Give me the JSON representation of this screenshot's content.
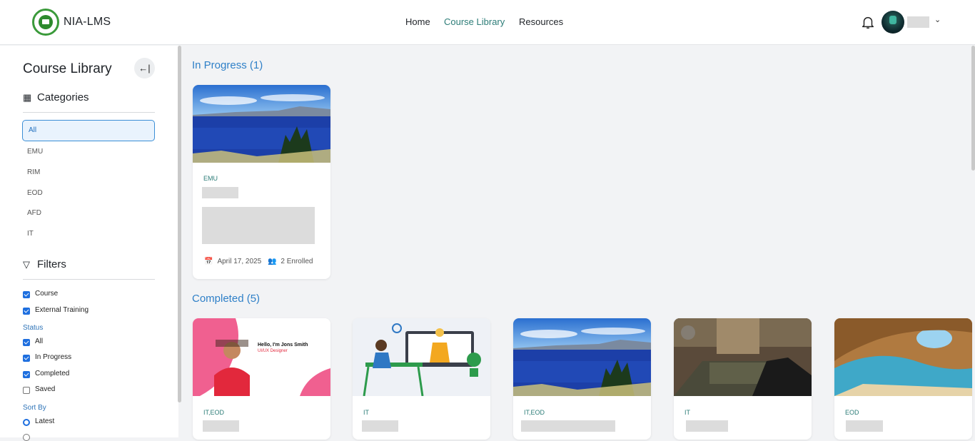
{
  "header": {
    "brand": "NIA-LMS",
    "nav": [
      {
        "label": "Home",
        "active": false
      },
      {
        "label": "Course Library",
        "active": true
      },
      {
        "label": "Resources",
        "active": false
      }
    ],
    "icons": [
      "bell-icon",
      "avatar",
      "chevron-down-icon"
    ]
  },
  "sidebar": {
    "title": "Course Library",
    "collapse_icon": "←|",
    "categories_label": "Categories",
    "categories": [
      "All",
      "EMU",
      "RIM",
      "EOD",
      "AFD",
      "IT"
    ],
    "selected_category": "All",
    "filters_label": "Filters",
    "type_filters": [
      {
        "label": "Course",
        "checked": true
      },
      {
        "label": "External Training",
        "checked": true
      }
    ],
    "status_label": "Status",
    "status_filters": [
      {
        "label": "All",
        "checked": true
      },
      {
        "label": "In Progress",
        "checked": true
      },
      {
        "label": "Completed",
        "checked": true
      },
      {
        "label": "Saved",
        "checked": false
      }
    ],
    "sort_label": "Sort By",
    "sort_options": [
      {
        "label": "Latest",
        "selected": true
      }
    ]
  },
  "main": {
    "in_progress": {
      "title": "In Progress (1)",
      "cards": [
        {
          "tag": "EMU",
          "date": "April 17, 2025",
          "enrolled": "2 Enrolled",
          "thumb": "lake"
        }
      ]
    },
    "completed": {
      "title": "Completed (5)",
      "cards": [
        {
          "tag": "IT,EOD",
          "thumb": "portfolio"
        },
        {
          "tag": "IT",
          "thumb": "video-call"
        },
        {
          "tag": "IT,EOD",
          "thumb": "lake"
        },
        {
          "tag": "IT",
          "thumb": "game"
        },
        {
          "tag": "EOD",
          "thumb": "cave"
        }
      ]
    },
    "portfolio_thumb": {
      "greeting": "Hello, I'm Jons Smith",
      "role": "UI/UX Designer"
    }
  },
  "colors": {
    "accent_blue": "#2f80c8",
    "tag_teal": "#2d7d78",
    "checkbox_blue": "#1e6fdf"
  }
}
